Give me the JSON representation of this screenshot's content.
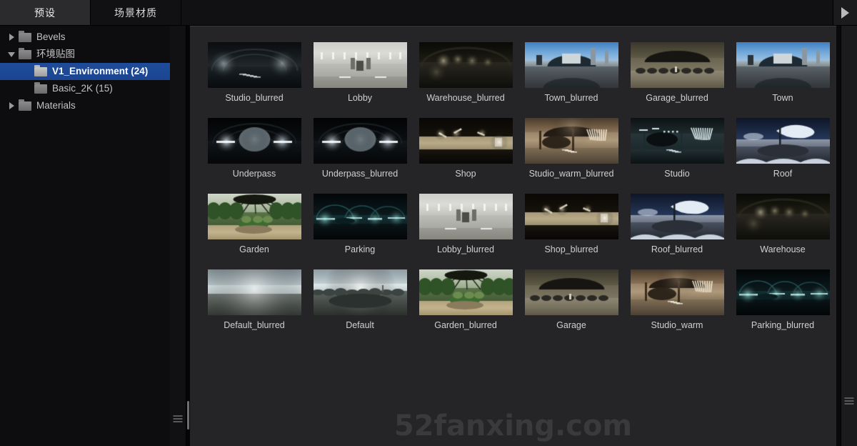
{
  "window": {
    "background_color": "#252528",
    "sidebar_color": "#0d0d0f",
    "accent_color": "#1e4c9a"
  },
  "tabs": {
    "items": [
      {
        "label": "预设",
        "active": true
      },
      {
        "label": "场景材质",
        "active": false
      }
    ],
    "scroll_right_icon": "triangle-right-icon"
  },
  "sidebar": {
    "tree": [
      {
        "label": "Bevels",
        "indent": 1,
        "arrow": "collapsed",
        "icon": "folder-icon",
        "selected": false
      },
      {
        "label": "环境贴图",
        "indent": 1,
        "arrow": "expanded",
        "icon": "folder-icon",
        "selected": false
      },
      {
        "label": "V1_Environment (24)",
        "indent": 2,
        "arrow": "none",
        "icon": "folder-open-icon",
        "selected": true
      },
      {
        "label": "Basic_2K (15)",
        "indent": 2,
        "arrow": "none",
        "icon": "folder-icon",
        "selected": false
      },
      {
        "label": "Materials",
        "indent": 1,
        "arrow": "collapsed",
        "icon": "folder-icon",
        "selected": false
      }
    ],
    "splitter_grip": "resize-grip-icon"
  },
  "content": {
    "watermark": "52fanxing.com",
    "scroll_grip": "scroll-grip-icon",
    "items": [
      {
        "label": "Studio_blurred",
        "style": "studio-dark"
      },
      {
        "label": "Lobby",
        "style": "lobby-bright"
      },
      {
        "label": "Warehouse_blurred",
        "style": "warehouse-dark"
      },
      {
        "label": "Town_blurred",
        "style": "town-blue"
      },
      {
        "label": "Garage_blurred",
        "style": "garage-tan"
      },
      {
        "label": "Town",
        "style": "town-blue"
      },
      {
        "label": "Underpass",
        "style": "underpass"
      },
      {
        "label": "Underpass_blurred",
        "style": "underpass"
      },
      {
        "label": "Shop",
        "style": "shop-warm"
      },
      {
        "label": "Studio_warm_blurred",
        "style": "studio-warm"
      },
      {
        "label": "Studio",
        "style": "studio-teal"
      },
      {
        "label": "Roof",
        "style": "roof-night"
      },
      {
        "label": "Garden",
        "style": "garden"
      },
      {
        "label": "Parking",
        "style": "parking-teal"
      },
      {
        "label": "Lobby_blurred",
        "style": "lobby-bright"
      },
      {
        "label": "Shop_blurred",
        "style": "shop-warm"
      },
      {
        "label": "Roof_blurred",
        "style": "roof-night"
      },
      {
        "label": "Warehouse",
        "style": "warehouse-dark"
      },
      {
        "label": "Default_blurred",
        "style": "default-sky-blur"
      },
      {
        "label": "Default",
        "style": "default-sky"
      },
      {
        "label": "Garden_blurred",
        "style": "garden"
      },
      {
        "label": "Garage",
        "style": "garage-tan"
      },
      {
        "label": "Studio_warm",
        "style": "studio-warm"
      },
      {
        "label": "Parking_blurred",
        "style": "parking-teal"
      }
    ]
  }
}
